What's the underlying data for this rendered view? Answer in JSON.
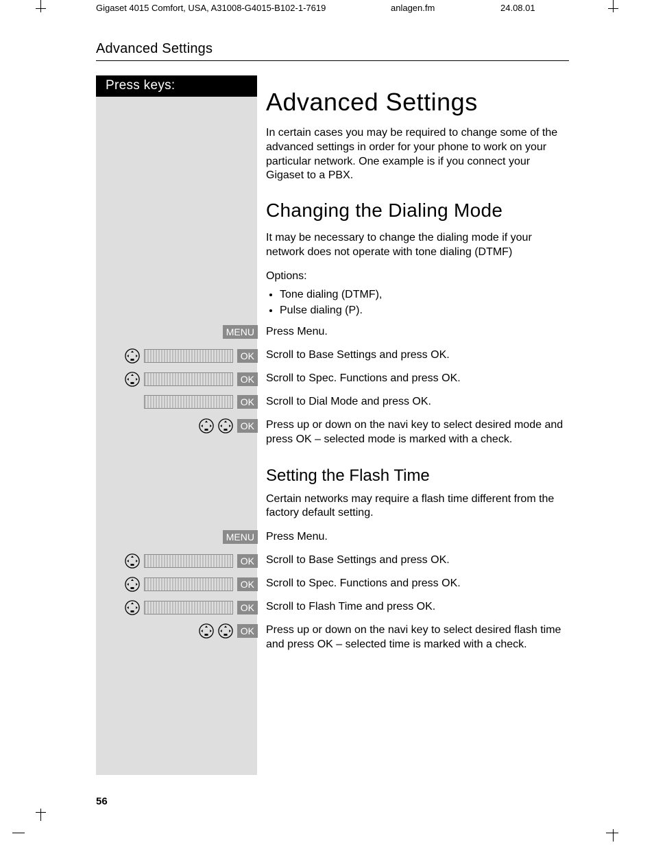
{
  "meta": {
    "docid": "Gigaset 4015 Comfort, USA, A31008-G4015-B102-1-7619",
    "filename": "anlagen.fm",
    "date": "24.08.01"
  },
  "running_head": "Advanced Settings",
  "sidebar_head": "Press keys:",
  "badges": {
    "menu": "MENU",
    "ok": "OK"
  },
  "content": {
    "h1": "Advanced Settings",
    "intro": "In certain cases you may be required to change some of the advanced settings in order for your phone to work on your particular network.  One example is if you connect your Gigaset to a PBX.",
    "section1": {
      "title": "Changing the Dialing Mode",
      "p1": "It may be  necessary to change the dialing mode if your network does not operate with tone dialing (DTMF)",
      "options_label": "Options:",
      "options": [
        "Tone dialing (DTMF),",
        "Pulse dialing (P)."
      ],
      "steps": [
        "Press Menu.",
        "Scroll to Base Settings and press OK.",
        "Scroll to Spec. Functions and press OK.",
        "Scroll to Dial Mode and press OK.",
        "Press up or down on the navi key to select desired mode and press OK – selected mode is marked with a check."
      ]
    },
    "section2": {
      "title": "Setting the Flash Time",
      "p1": "Certain networks may require a flash time different from the factory default setting.",
      "steps": [
        "Press Menu.",
        "Scroll to Base Settings and press OK.",
        "Scroll to Spec. Functions and press OK.",
        "Scroll to Flash Time and press OK.",
        "Press up or down on the navi key to select desired flash time and press OK – selected time is marked with a check."
      ]
    }
  },
  "page_number": "56"
}
